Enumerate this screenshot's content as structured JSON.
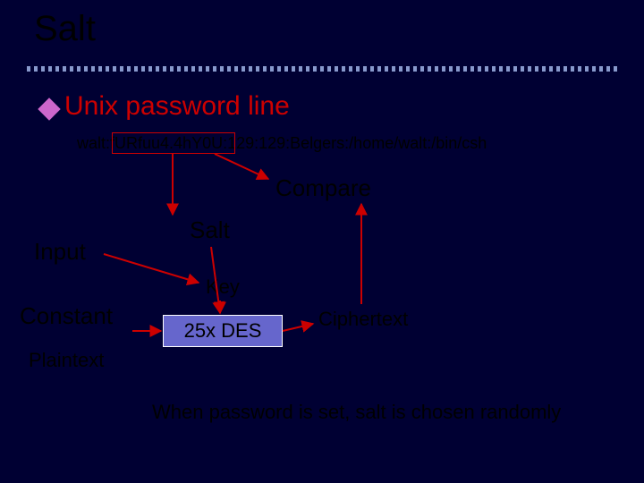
{
  "title": "Salt",
  "subheading": "Unix password line",
  "password_line": "walt:fURfuu4.4hY0U:129:129:Belgers:/home/walt:/bin/csh",
  "labels": {
    "compare": "Compare",
    "salt": "Salt",
    "input": "Input",
    "key": "Key",
    "constant": "Constant",
    "ciphertext": "Ciphertext",
    "plaintext": "Plaintext",
    "des": "25x DES"
  },
  "footnote": "When password is set, salt is chosen randomly",
  "colors": {
    "background": "#000033",
    "accent": "#cc0000",
    "bullet": "#cc66cc",
    "box": "#6666cc"
  }
}
